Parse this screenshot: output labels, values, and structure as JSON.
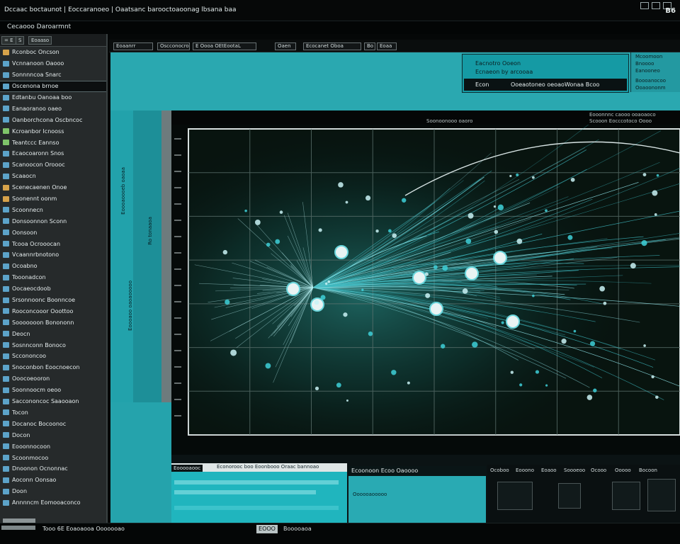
{
  "window": {
    "title": "Dccaac boctaunot | Eoccaranoeo | Oaatsanc barooctoaoonag lbsana baa",
    "number": "B6",
    "subtitle": "Cecaooo Daroarmnt"
  },
  "sidebar": {
    "tabs": [
      "= E",
      "S",
      "Eoaaso"
    ],
    "items": [
      {
        "label": "Rconboc Oncson",
        "icon": "folder-icon"
      },
      {
        "label": "Vcnnanoon Oaooo",
        "icon": "file-icon"
      },
      {
        "label": "Sonnnncoa Snarc",
        "icon": "file-icon"
      },
      {
        "label": "Oscenona brnoe",
        "icon": "file-icon"
      },
      {
        "label": "Edtanbu Oanoaa boo",
        "icon": "file-icon"
      },
      {
        "label": "Eanaoranoo oaeo",
        "icon": "file-icon"
      },
      {
        "label": "Oanborchcona Oscbncoc",
        "icon": "file-icon"
      },
      {
        "label": "Kcroanbor Icnooss",
        "icon": "chart-icon"
      },
      {
        "label": "Teantccc Eannso",
        "icon": "chart-icon"
      },
      {
        "label": "Ecaocoaronn Snos",
        "icon": "file-icon"
      },
      {
        "label": "Scanoocon Oroooc",
        "icon": "file-icon"
      },
      {
        "label": "Scaaocn",
        "icon": "file-icon"
      },
      {
        "label": "Scenecaenen Onoe",
        "icon": "folder-icon"
      },
      {
        "label": "Soonennt oonm",
        "icon": "folder-icon"
      },
      {
        "label": "Scoonnecn",
        "icon": "file-icon"
      },
      {
        "label": "Donsoonnon Sconn",
        "icon": "file-icon"
      },
      {
        "label": "Oonsoon",
        "icon": "file-icon"
      },
      {
        "label": "Tcooa Ocrooocan",
        "icon": "file-icon"
      },
      {
        "label": "Vcaannrbnotono",
        "icon": "file-icon"
      },
      {
        "label": "Ocoabno",
        "icon": "file-icon"
      },
      {
        "label": "Tooonadcon",
        "icon": "file-icon"
      },
      {
        "label": "Oocaeocdoob",
        "icon": "file-icon"
      },
      {
        "label": "Srsonnoonc Boonncoe",
        "icon": "file-icon"
      },
      {
        "label": "Rooconcooor Ooottoo",
        "icon": "file-icon"
      },
      {
        "label": "Sooooooon Bonononn",
        "icon": "file-icon"
      },
      {
        "label": "Deocn",
        "icon": "file-icon"
      },
      {
        "label": "Sosnnconn Bonoco",
        "icon": "file-icon"
      },
      {
        "label": "Sccononcoo",
        "icon": "file-icon"
      },
      {
        "label": "Snoconbon Eoocnoecon",
        "icon": "file-icon"
      },
      {
        "label": "Ooocoeooron",
        "icon": "file-icon"
      },
      {
        "label": "Soonnoocm oeoo",
        "icon": "file-icon"
      },
      {
        "label": "Saccononcoc Saaooaon",
        "icon": "file-icon"
      },
      {
        "label": "Tocon",
        "icon": "file-icon"
      },
      {
        "label": "Docanoc Bocoonoc",
        "icon": "file-icon"
      },
      {
        "label": "Docon",
        "icon": "file-icon"
      },
      {
        "label": "Eooonnocoon",
        "icon": "file-icon"
      },
      {
        "label": "Scoonmocoo",
        "icon": "file-icon"
      },
      {
        "label": "Dnoonon Ocnonnac",
        "icon": "file-icon"
      },
      {
        "label": "Aoconn Oonsao",
        "icon": "file-icon"
      },
      {
        "label": "Doon",
        "icon": "file-icon"
      },
      {
        "label": "Annnncm Eomooaconco",
        "icon": "file-icon"
      }
    ]
  },
  "toolbar": {
    "buttons": [
      "Eoaanrr",
      "Oscconocro",
      "E Oooa OEtEootaL",
      "Oaen",
      "Ecocanet Oboa",
      "Bo",
      "Eoaa"
    ]
  },
  "header": {
    "card_line1": "Eacnotro Ooeon",
    "card_line2": "Ecnaeon by arcooaa",
    "bar_items": [
      "Econ",
      "Ooeaotoneo oeoao",
      "Wonaa Bcoo"
    ],
    "side_lines": [
      "Mcoomoon",
      "Bnoooo",
      "Eanooneo",
      "Boooanocoo",
      "Ooaoononm"
    ]
  },
  "left_panel": {
    "vtext1": "Eoooaoooeb oaoaa",
    "vtext2": "Ro tonaaoa",
    "vtext3": "Eoooaoo oaoaooooo"
  },
  "plot": {
    "top_labels": [
      "Eooonnnc caooo ooaoaoco",
      "Scooon Eocccotoco Oooo",
      "Soonoonooo oaoro"
    ]
  },
  "bottom": {
    "head": "Econorooc boo Eoonbooo Oraac bannoao",
    "tab": "Eooooaooc",
    "mid_head": "Ecoonoon  Ecoo  Oaoooo",
    "mid_sub": "Oooooaooooo",
    "right_items": [
      "Ocoboo",
      "Eooono",
      "Eoaoo",
      "Soooeoo",
      "Ocooo",
      "Ooooo",
      "Bocoon"
    ]
  },
  "status": {
    "left": "Tooo 6E Eoaoaooa Ooooooao",
    "box": "EOOO",
    "right": "Booooaoa"
  },
  "colors": {
    "accent": "#2aa8b0",
    "background": "#050707",
    "sidebar": "#262a2b",
    "plot_background": "#050a09"
  }
}
